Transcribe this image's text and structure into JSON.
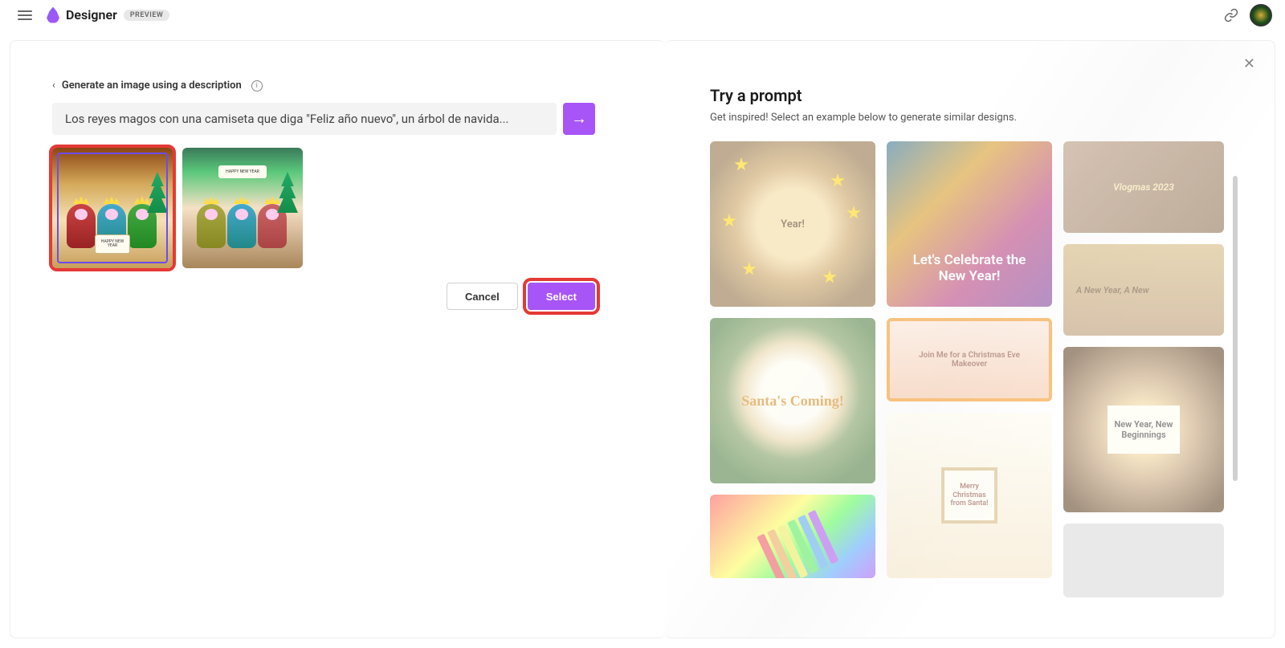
{
  "header": {
    "brand": "Designer",
    "badge": "PREVIEW"
  },
  "left": {
    "back_label": "Generate an image using a description",
    "prompt": "Los reyes magos con una camiseta que diga \"Feliz año nuevo\", un árbol de navida...",
    "sign1": "HAPPY NEW YEAR",
    "banner2": "HAPPY NEW YEAR",
    "cancel": "Cancel",
    "select": "Select"
  },
  "right": {
    "title": "Try a prompt",
    "subtitle": "Get inspired! Select an example below to generate similar designs.",
    "tiles": {
      "t1": "Year!",
      "t2": "Let's Celebrate the New Year!",
      "t3": "Vlogmas 2023",
      "t4": "A New Year, A New",
      "t5": "Santa's Coming!",
      "t6": "Join Me for a Christmas Eve Makeover",
      "t7": "Merry Christmas from Santa!",
      "t8": "New Year, New Beginnings"
    }
  }
}
